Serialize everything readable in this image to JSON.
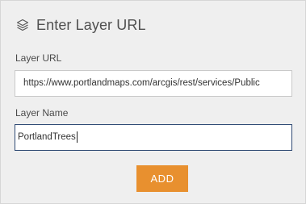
{
  "panel": {
    "title": "Enter Layer URL",
    "title_icon": "layers-icon"
  },
  "form": {
    "url_label": "Layer URL",
    "url_value": "https://www.portlandmaps.com/arcgis/rest/services/Public",
    "name_label": "Layer Name",
    "name_value": "PortlandTrees"
  },
  "actions": {
    "add_label": "ADD"
  },
  "colors": {
    "accent": "#e8902f",
    "panel_bg": "#efefef",
    "focused_border": "#2f4a74"
  }
}
